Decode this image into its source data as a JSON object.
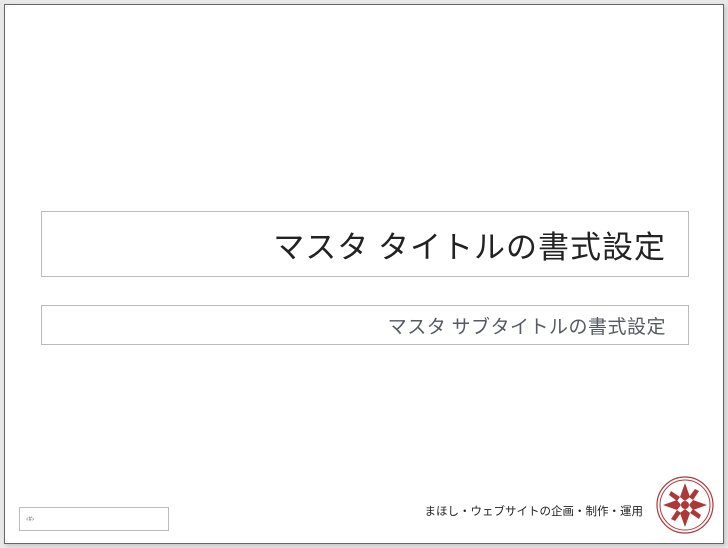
{
  "slide": {
    "title": "マスタ タイトルの書式設定",
    "subtitle": "マスタ サブタイトルの書式設定",
    "page_number": "‹#›",
    "footer": "まほし・ウェブサイトの企画・制作・運用"
  },
  "colors": {
    "logo_primary": "#AE3838"
  }
}
